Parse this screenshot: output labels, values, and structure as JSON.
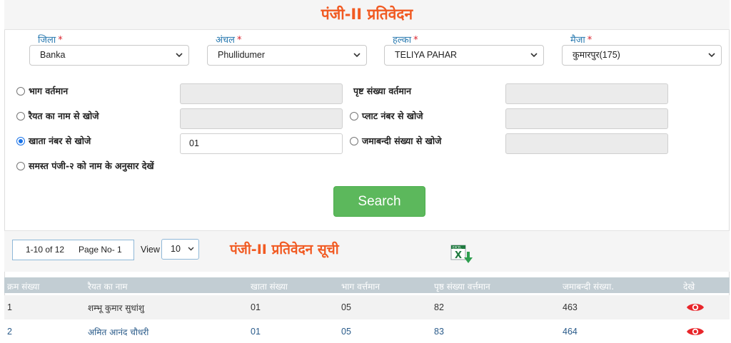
{
  "page_title": "पंजी-II प्रतिवेदन",
  "filters": [
    {
      "label": "जिला",
      "value": "Banka"
    },
    {
      "label": "अंचल",
      "value": "Phullidumer"
    },
    {
      "label": "हल्का",
      "value": "TELIYA PAHAR"
    },
    {
      "label": "मैजा",
      "value": "कुमारपुर(175)"
    }
  ],
  "required_mark": "*",
  "search_options": {
    "left": [
      {
        "label": "भाग वर्तमान",
        "checked": false,
        "input_value": ""
      },
      {
        "label": "रैयत का नाम से खोजे",
        "checked": false,
        "input_value": ""
      },
      {
        "label": "खाता नंबर से खोजे",
        "checked": true,
        "input_value": "01"
      },
      {
        "label": "समस्त पंजी-२ को नाम के अनुसार देखें",
        "checked": false
      }
    ],
    "right": [
      {
        "label": "पृष्ट संख्या वर्तमान",
        "has_radio": false,
        "input_value": ""
      },
      {
        "label": "प्लाट नंबर से खोजे",
        "has_radio": true,
        "checked": false,
        "input_value": ""
      },
      {
        "label": "जमाबन्दी संख्या से खोजे",
        "has_radio": true,
        "checked": false,
        "input_value": ""
      }
    ]
  },
  "search_button": "Search",
  "list": {
    "range": "1-10 of 12",
    "page_no": "Page No- 1",
    "view_label": "View",
    "view_value": "10",
    "title": "पंजी-II प्रतिवेदन सूची",
    "excel_icon": "excel-export-icon"
  },
  "table": {
    "headers": [
      "क्रम संख्या",
      "रैयत का नाम",
      "खाता संख्या",
      "भाग वर्त्तमान",
      "पृष्ठ संख्या वर्त्तमान",
      "जमाबन्दी संख्या.",
      "देखे"
    ],
    "rows": [
      [
        "1",
        "शम्भू कुमार सुधांशु",
        "01",
        "05",
        "82",
        "463"
      ],
      [
        "2",
        "अमित आनंद चौधरी",
        "01",
        "05",
        "83",
        "464"
      ]
    ]
  },
  "colors": {
    "accent_orange": "#f15a22",
    "label_blue": "#2a7ab0",
    "search_green": "#5cb85c",
    "header_gray": "#c2cdd3",
    "eye_red": "#e8262b"
  }
}
